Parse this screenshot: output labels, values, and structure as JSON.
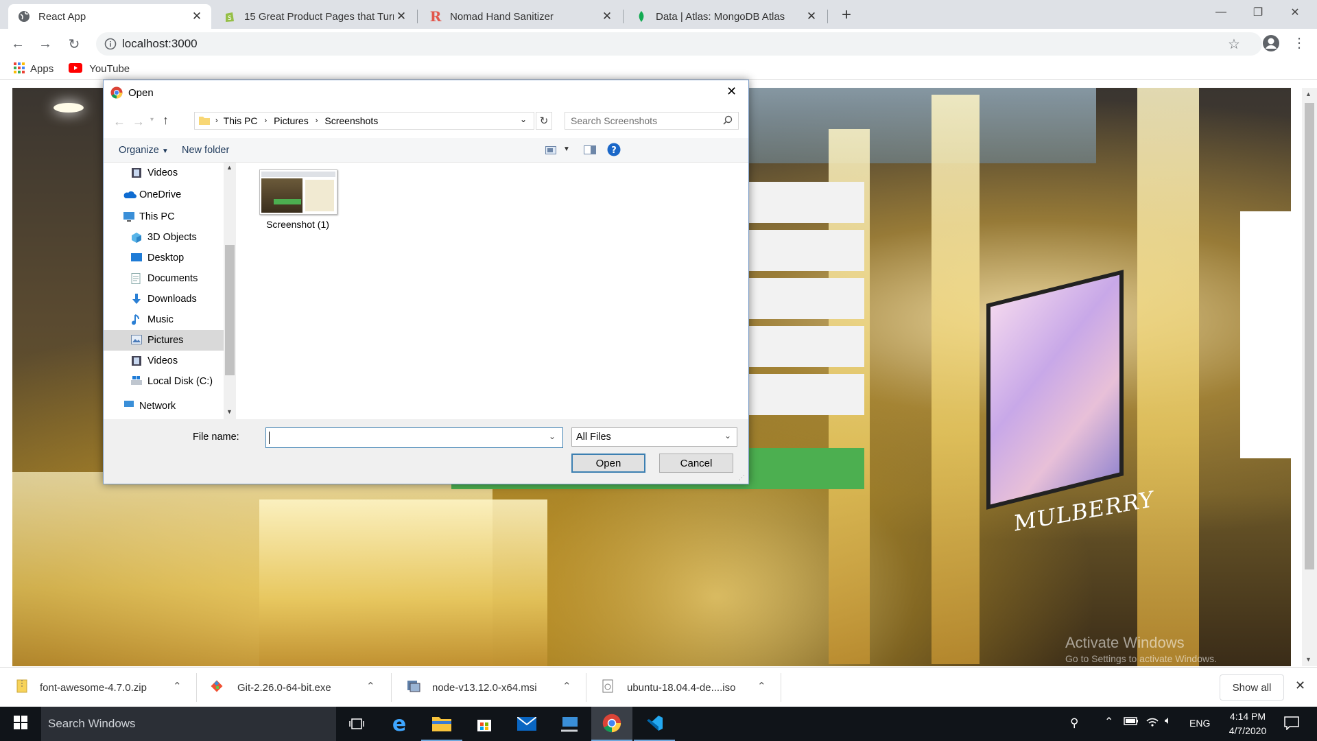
{
  "browser": {
    "tabs": [
      {
        "title": "React App",
        "active": true
      },
      {
        "title": "15 Great Product Pages that Turn",
        "active": false
      },
      {
        "title": "Nomad Hand Sanitizer",
        "active": false
      },
      {
        "title": "Data | Atlas: MongoDB Atlas",
        "active": false
      }
    ],
    "new_tab_icon": "plus-icon",
    "address": "localhost:3000",
    "bookmarks": [
      {
        "label": "Apps",
        "icon": "apps-grid-icon"
      },
      {
        "label": "YouTube",
        "icon": "youtube-icon"
      }
    ]
  },
  "page": {
    "storefront_sign": "MULBERRY",
    "watermark_title": "Activate Windows",
    "watermark_sub": "Go to Settings to activate Windows."
  },
  "dialog": {
    "title": "Open",
    "path": [
      "This PC",
      "Pictures",
      "Screenshots"
    ],
    "search_placeholder": "Search Screenshots",
    "organize_label": "Organize",
    "new_folder_label": "New folder",
    "nav_items": [
      {
        "label": "Videos",
        "icon": "videos-icon",
        "indent": 1
      },
      {
        "label": "OneDrive",
        "icon": "onedrive-icon",
        "indent": 0
      },
      {
        "label": "This PC",
        "icon": "this-pc-icon",
        "indent": 0
      },
      {
        "label": "3D Objects",
        "icon": "3d-objects-icon",
        "indent": 1
      },
      {
        "label": "Desktop",
        "icon": "desktop-icon",
        "indent": 1
      },
      {
        "label": "Documents",
        "icon": "documents-icon",
        "indent": 1
      },
      {
        "label": "Downloads",
        "icon": "downloads-icon",
        "indent": 1
      },
      {
        "label": "Music",
        "icon": "music-icon",
        "indent": 1
      },
      {
        "label": "Pictures",
        "icon": "pictures-icon",
        "indent": 1,
        "selected": true
      },
      {
        "label": "Videos",
        "icon": "videos-icon",
        "indent": 1
      },
      {
        "label": "Local Disk (C:)",
        "icon": "local-disk-icon",
        "indent": 1
      },
      {
        "label": "Network",
        "icon": "network-icon",
        "indent": 0
      }
    ],
    "files": [
      {
        "name": "Screenshot (1)"
      }
    ],
    "file_name_label": "File name:",
    "file_name_value": "",
    "file_type": "All Files",
    "open_label": "Open",
    "cancel_label": "Cancel"
  },
  "downloads": {
    "items": [
      {
        "name": "font-awesome-4.7.0.zip",
        "icon": "zip-icon"
      },
      {
        "name": "Git-2.26.0-64-bit.exe",
        "icon": "git-icon"
      },
      {
        "name": "node-v13.12.0-x64.msi",
        "icon": "msi-icon"
      },
      {
        "name": "ubuntu-18.04.4-de....iso",
        "icon": "iso-icon"
      }
    ],
    "show_all_label": "Show all"
  },
  "taskbar": {
    "search_placeholder": "Search Windows",
    "language": "ENG",
    "time": "4:14 PM",
    "date": "4/7/2020",
    "apps": [
      "task-view-icon",
      "edge-icon",
      "file-explorer-icon",
      "store-icon",
      "mail-icon",
      "remote-desktop-icon",
      "chrome-icon",
      "vscode-icon"
    ]
  }
}
